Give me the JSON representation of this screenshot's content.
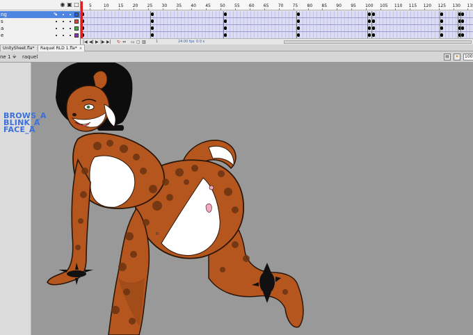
{
  "timeline": {
    "ruler_numbers": [
      "5",
      "10",
      "15",
      "20",
      "25",
      "30",
      "35",
      "40",
      "45",
      "50",
      "55",
      "60",
      "65",
      "70",
      "75",
      "80",
      "85",
      "90",
      "95",
      "100",
      "105",
      "110",
      "115",
      "120",
      "125",
      "130",
      "135"
    ],
    "layers": [
      {
        "name": "ng",
        "color": "#2b5fd9",
        "selected": true
      },
      {
        "name": "s",
        "color": "#e0453a",
        "selected": false
      },
      {
        "name": "a",
        "color": "#3fae3f",
        "selected": false
      },
      {
        "name": "e",
        "color": "#8b33b6",
        "selected": false
      }
    ],
    "fps": "24.00 fps",
    "time": "0.0 s",
    "current_frame": "1"
  },
  "tabs": [
    {
      "label": "UnitySheet.fla*",
      "close": "×"
    },
    {
      "label": "Raquel RLD 1.fla*",
      "close": "×"
    }
  ],
  "editbar": {
    "scene": "ne 1",
    "symbol": "raquel",
    "zoom": "100%"
  },
  "stage": {
    "labels": [
      "BROWS_A",
      "BLINK_A",
      "FACE_A"
    ]
  },
  "colors": {
    "selection": "#4d85e0",
    "stage_bg": "#999999",
    "label_blue": "#3b70dc",
    "fur_orange": "#b5561e",
    "fur_white": "#ffffff",
    "spots": "#6b3312"
  }
}
